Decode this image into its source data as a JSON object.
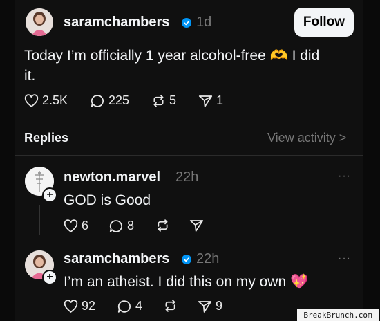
{
  "post": {
    "username": "saramchambers",
    "time": "1d",
    "follow_label": "Follow",
    "text_line1": "Today I’m officially 1 year alcohol-free 🫶 I did",
    "text_line2": "it.",
    "likes": "2.5K",
    "comments": "225",
    "reposts": "5",
    "shares": "1"
  },
  "replies_header": {
    "label": "Replies",
    "view_activity": "View activity >"
  },
  "replies": [
    {
      "username": "newton.marvel",
      "time": "22h",
      "text": "GOD is Good",
      "likes": "6",
      "comments": "8",
      "reposts": "",
      "shares": ""
    },
    {
      "username": "saramchambers",
      "time": "22h",
      "text": "I’m an atheist. I did this on my own 💖",
      "likes": "92",
      "comments": "4",
      "reposts": "",
      "shares": "9"
    }
  ],
  "more_label": "···",
  "watermark": "BreakBrunch.com",
  "colors": {
    "background": "#101010",
    "text": "#f3f5f7",
    "muted": "#777777",
    "verified": "#0095f6"
  }
}
